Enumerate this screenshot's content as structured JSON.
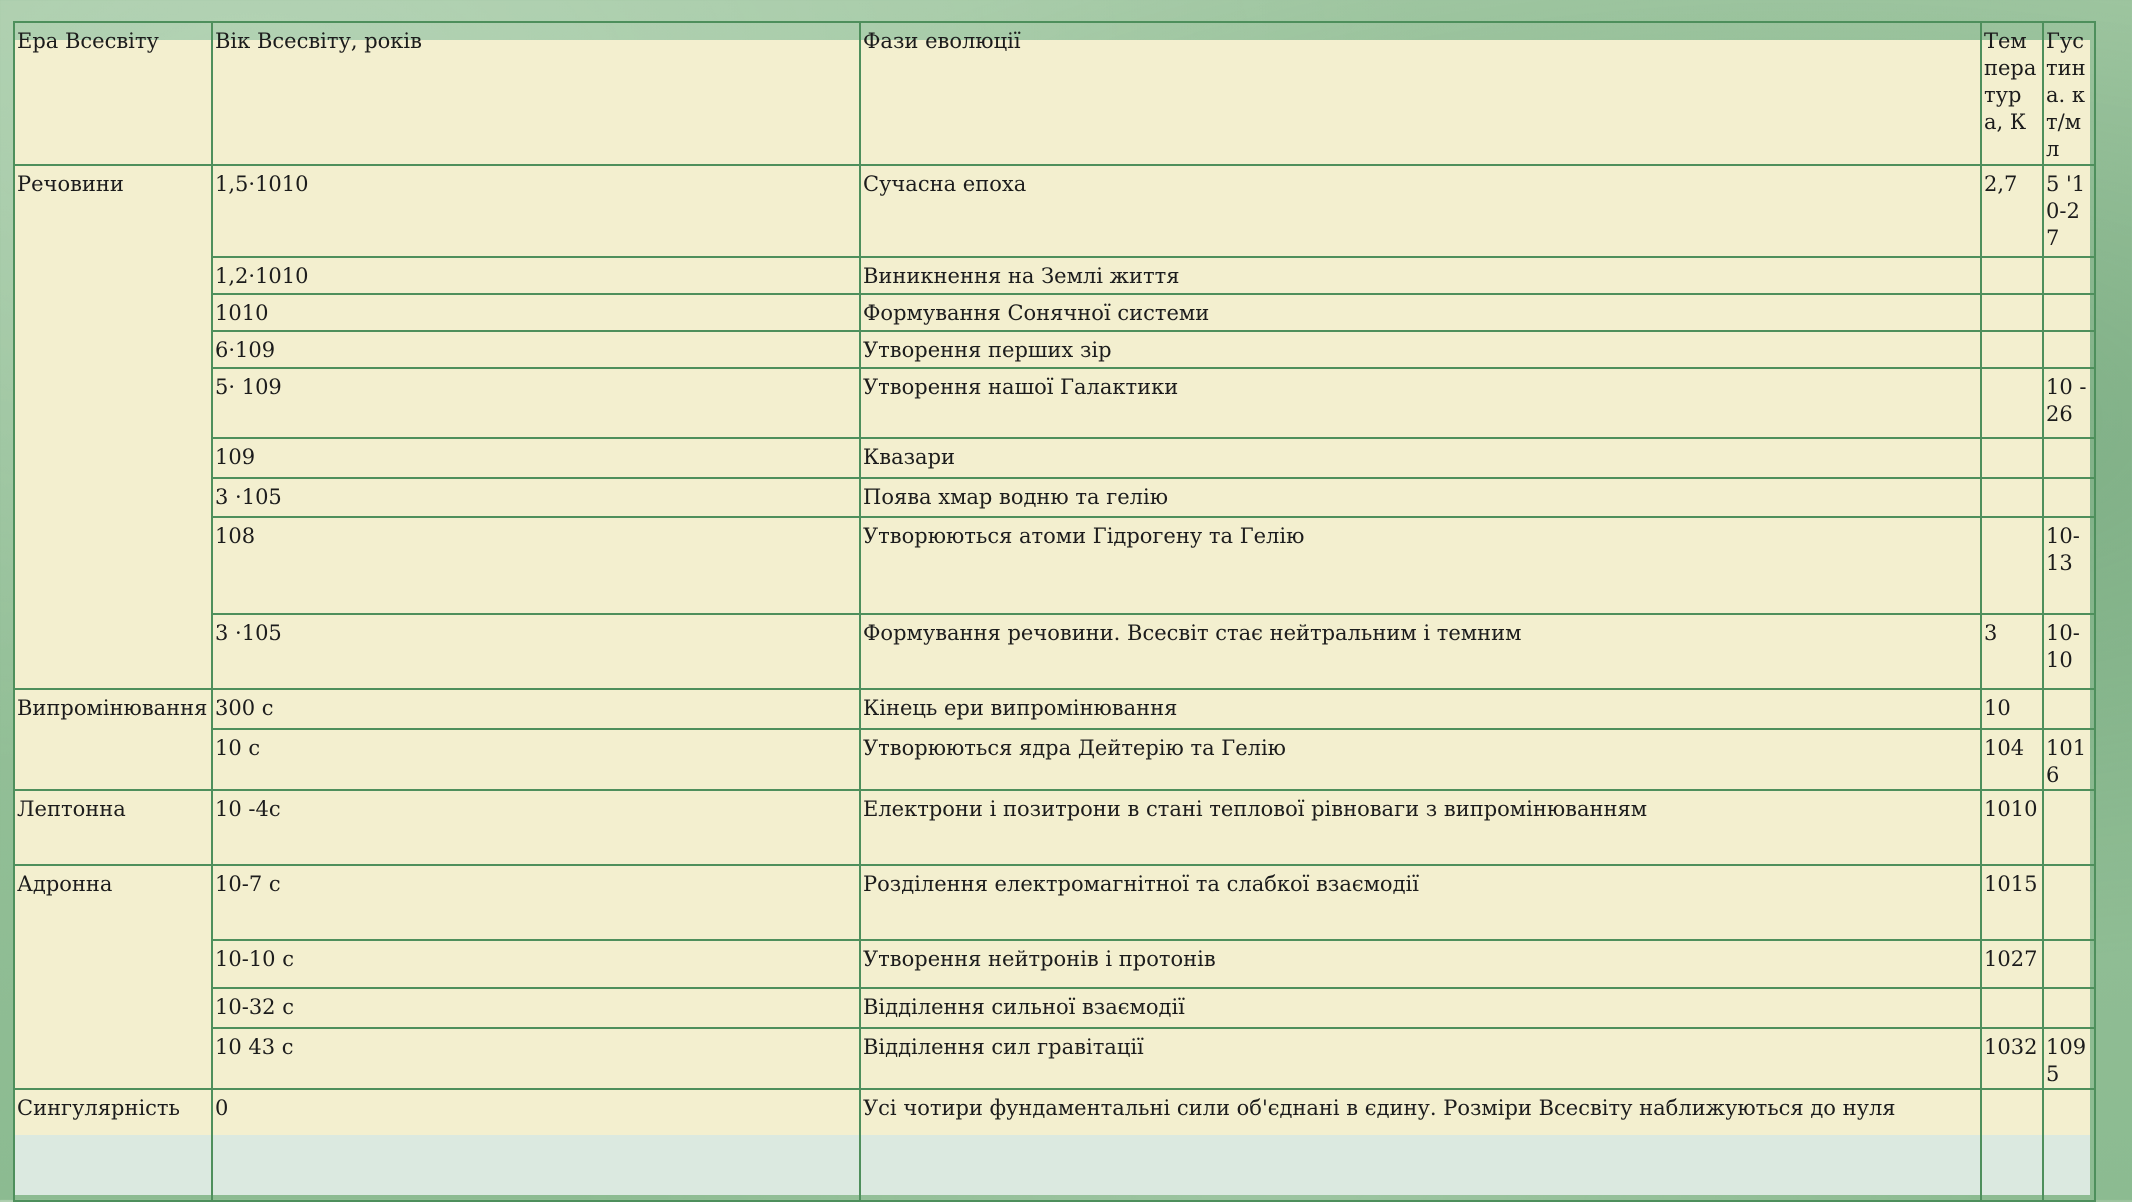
{
  "table": {
    "headers": {
      "era": "Ера Всесвіту",
      "age": "Вік Всесвіту, років",
      "phase": "Фази еволюції",
      "temperature": "Температура, К",
      "density": "Густина. кт/мл"
    },
    "rows": [
      {
        "era": "Речовини",
        "age": "1,5·1010",
        "phase": "Сучасна епоха",
        "temperature": "2,7",
        "density": "5 '10-27"
      },
      {
        "era": "",
        "age": "1,2·1010",
        "phase": "Виникнення на Землі життя",
        "temperature": "",
        "density": ""
      },
      {
        "era": "",
        "age": "1010",
        "phase": "Формування Сонячної системи",
        "temperature": "",
        "density": ""
      },
      {
        "era": "",
        "age": "6·109",
        "phase": "Утворення перших зір",
        "temperature": "",
        "density": ""
      },
      {
        "era": "",
        "age": "5· 109",
        "phase": "Утворення нашої Галактики",
        "temperature": "",
        "density": "10 -26"
      },
      {
        "era": "",
        "age": "109",
        "phase": "Квазари",
        "temperature": "",
        "density": ""
      },
      {
        "era": "",
        "age": "3 ·105",
        "phase": "Поява хмар водню та гелію",
        "temperature": "",
        "density": ""
      },
      {
        "era": "",
        "age": "108",
        "phase": "Утворюються атоми Гідрогену та Гелію",
        "temperature": "",
        "density": "10-13"
      },
      {
        "era": "",
        "age": "3 ·105",
        "phase": "Формування речовини. Всесвіт стає нейтральним і темним",
        "temperature": "3",
        "density": "10-10"
      },
      {
        "era": "Випромінювання",
        "age": "300 с",
        "phase": "Кінець ери випромінювання",
        "temperature": "10",
        "density": ""
      },
      {
        "era": "",
        "age": "10 с",
        "phase": "Утворюються ядра Дейтерію та Гелію",
        "temperature": "104",
        "density": "1016"
      },
      {
        "era": "Лептонна",
        "age": "10 -4с",
        "phase": "Електрони і позитрони в стані теплової рівноваги з випромінюванням",
        "temperature": "1010",
        "density": ""
      },
      {
        "era": "Адронна",
        "age": "10-7 с",
        "phase": "Розділення електромагнітної та слабкої взаємодії",
        "temperature": "1015",
        "density": ""
      },
      {
        "era": "",
        "age": "10-10 с",
        "phase": "Утворення нейтронів і протонів",
        "temperature": "1027",
        "density": ""
      },
      {
        "era": "",
        "age": "10-32 с",
        "phase": "Відділення сильної взаємодії",
        "temperature": "",
        "density": ""
      },
      {
        "era": "",
        "age": "10 43 с",
        "phase": "Відділення сил гравітації",
        "temperature": "1032",
        "density": "1095"
      },
      {
        "era": "Сингулярність",
        "age": "0",
        "phase": "Усі чотири фундаментальні сили об'єднані в єдину. Розміри Всесвіту наближуються до нуля",
        "temperature": "",
        "density": ""
      }
    ]
  }
}
